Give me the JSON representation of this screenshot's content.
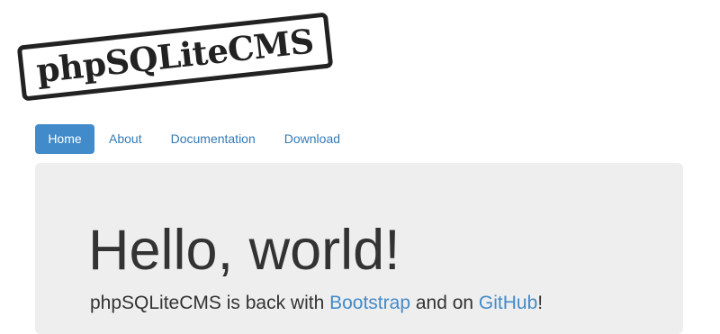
{
  "logo": {
    "text": "phpSQLiteCMS"
  },
  "nav": {
    "items": [
      {
        "label": "Home",
        "active": true
      },
      {
        "label": "About",
        "active": false
      },
      {
        "label": "Documentation",
        "active": false
      },
      {
        "label": "Download",
        "active": false
      }
    ]
  },
  "jumbotron": {
    "heading": "Hello, world!",
    "lead": {
      "prefix": "phpSQLiteCMS is back with ",
      "link1": "Bootstrap",
      "middle": " and on ",
      "link2": "GitHub",
      "suffix": "!"
    }
  },
  "colors": {
    "accent": "#428bca",
    "link": "#337ab7",
    "jumbotron_bg": "#eeeeee",
    "text": "#333333"
  }
}
